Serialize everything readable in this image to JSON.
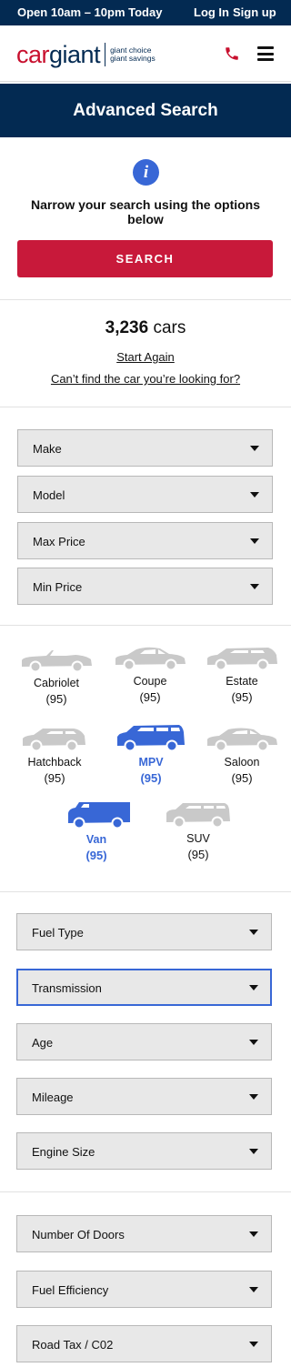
{
  "topbar": {
    "hours": "Open 10am – 10pm Today",
    "login": "Log In",
    "signup": "Sign up"
  },
  "header": {
    "logo_car": "car",
    "logo_giant": "giant",
    "tagline_1": "giant choice",
    "tagline_2": "giant savings",
    "phone_icon": "phone-icon",
    "menu_icon": "hamburger-menu-icon"
  },
  "hero": {
    "title": "Advanced Search"
  },
  "intro": {
    "info_icon": "i",
    "text": "Narrow your search using the options below",
    "search_label": "SEARCH"
  },
  "results": {
    "count": "3,236",
    "unit": "cars",
    "start_again": "Start Again",
    "cant_find": "Can’t find the car you’re looking for?"
  },
  "filters_primary": [
    "Make",
    "Model",
    "Max Price",
    "Min Price"
  ],
  "body_types": [
    {
      "name": "Cabriolet",
      "count": "(95)",
      "selected": false
    },
    {
      "name": "Coupe",
      "count": "(95)",
      "selected": false
    },
    {
      "name": "Estate",
      "count": "(95)",
      "selected": false
    },
    {
      "name": "Hatchback",
      "count": "(95)",
      "selected": false
    },
    {
      "name": "MPV",
      "count": "(95)",
      "selected": true
    },
    {
      "name": "Saloon",
      "count": "(95)",
      "selected": false
    },
    {
      "name": "Van",
      "count": "(95)",
      "selected": true
    },
    {
      "name": "SUV",
      "count": "(95)",
      "selected": false
    }
  ],
  "filters_secondary": [
    "Fuel Type",
    "Transmission",
    "Age",
    "Mileage",
    "Engine Size"
  ],
  "filters_tertiary": [
    "Number Of Doors",
    "Fuel Efficiency",
    "Road Tax / C02"
  ],
  "colors": {
    "navy": "#032a52",
    "brand_red": "#c8102e",
    "selected_blue": "#3867d6",
    "inactive_car": "#c9c9c9"
  }
}
